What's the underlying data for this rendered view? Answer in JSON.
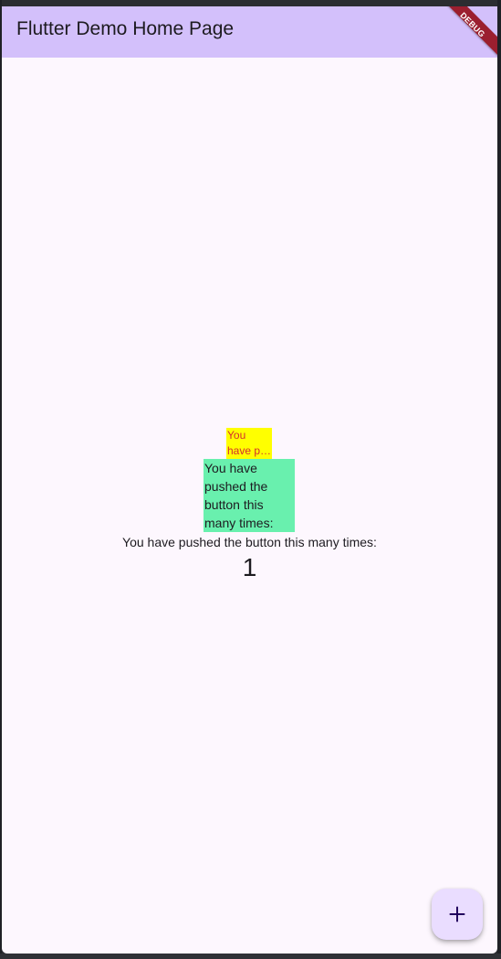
{
  "app_bar": {
    "title": "Flutter Demo Home Page",
    "debug_label": "DEBUG"
  },
  "content": {
    "yellow_box_text": "You have pushed the button this many times:",
    "green_box_text": "You have pushed the button this many times:",
    "label_text": "You have pushed the button this many times:",
    "counter_value": "1"
  },
  "fab": {
    "icon": "add-icon"
  },
  "colors": {
    "app_bar": "#d3c0fb",
    "background": "#fdf7fe",
    "yellow_box": "#ffff00",
    "yellow_text": "#d32f2f",
    "green_box": "#69f0ae",
    "fab": "#eaddff",
    "debug_banner": "#9b1f2f"
  }
}
